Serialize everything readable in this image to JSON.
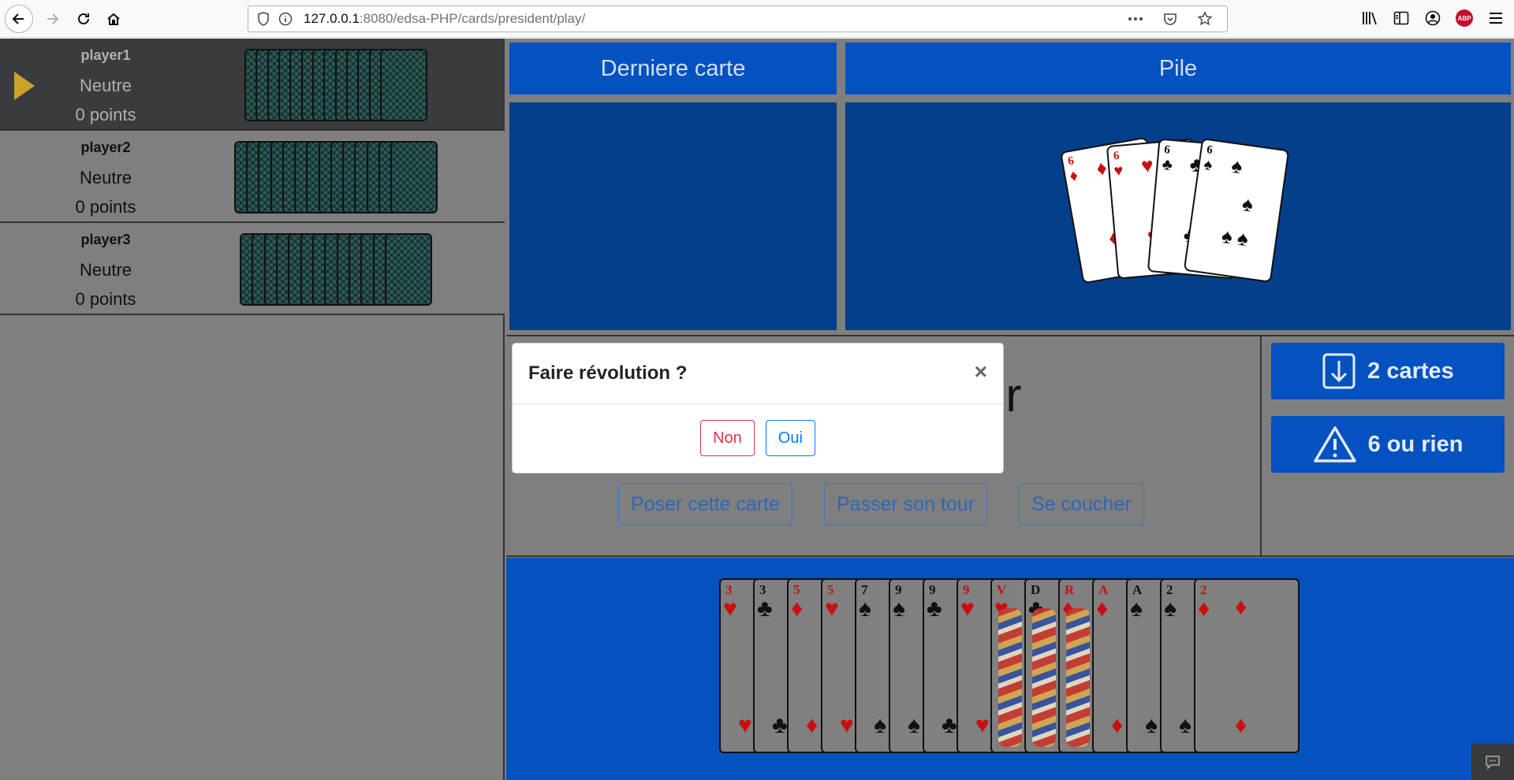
{
  "browser": {
    "url_host": "127.0.0.1",
    "url_rest": ":8080/edsa-PHP/cards/president/play/"
  },
  "players": [
    {
      "name": "player1",
      "status": "Neutre",
      "points": "0 points",
      "active": true
    },
    {
      "name": "player2",
      "status": "Neutre",
      "points": "0 points",
      "active": false
    },
    {
      "name": "player3",
      "status": "Neutre",
      "points": "0 points",
      "active": false
    }
  ],
  "board": {
    "last_card_header": "Derniere carte",
    "pile_header": "Pile",
    "pile_cards": [
      {
        "rank": "6",
        "suit": "♦",
        "color": "red"
      },
      {
        "rank": "6",
        "suit": "♥",
        "color": "red"
      },
      {
        "rank": "6",
        "suit": "♣",
        "color": "black"
      },
      {
        "rank": "6",
        "suit": "♠",
        "color": "black"
      }
    ],
    "big_text_visible": "er"
  },
  "actions": {
    "play": "Poser cette carte",
    "pass": "Passer son tour",
    "fold": "Se coucher"
  },
  "side": {
    "cards_button": "2 cartes",
    "six_button": "6 ou rien"
  },
  "hand_cards": [
    {
      "rank": "3",
      "suit": "♥",
      "color": "red"
    },
    {
      "rank": "3",
      "suit": "♣",
      "color": "black"
    },
    {
      "rank": "5",
      "suit": "♦",
      "color": "red"
    },
    {
      "rank": "5",
      "suit": "♥",
      "color": "red"
    },
    {
      "rank": "7",
      "suit": "♠",
      "color": "black"
    },
    {
      "rank": "9",
      "suit": "♠",
      "color": "black"
    },
    {
      "rank": "9",
      "suit": "♣",
      "color": "black"
    },
    {
      "rank": "9",
      "suit": "♥",
      "color": "red"
    },
    {
      "rank": "V",
      "suit": "♥",
      "color": "red"
    },
    {
      "rank": "D",
      "suit": "♣",
      "color": "black"
    },
    {
      "rank": "R",
      "suit": "♦",
      "color": "red"
    },
    {
      "rank": "A",
      "suit": "♦",
      "color": "red"
    },
    {
      "rank": "A",
      "suit": "♠",
      "color": "black"
    },
    {
      "rank": "2",
      "suit": "♠",
      "color": "black"
    },
    {
      "rank": "2",
      "suit": "♦",
      "color": "red"
    }
  ],
  "modal": {
    "title": "Faire révolution ?",
    "close": "×",
    "no": "Non",
    "yes": "Oui"
  },
  "colors": {
    "board_blue": "#0451c0",
    "board_dark_blue": "#033f8a",
    "turn_indicator": "#c9a227"
  }
}
